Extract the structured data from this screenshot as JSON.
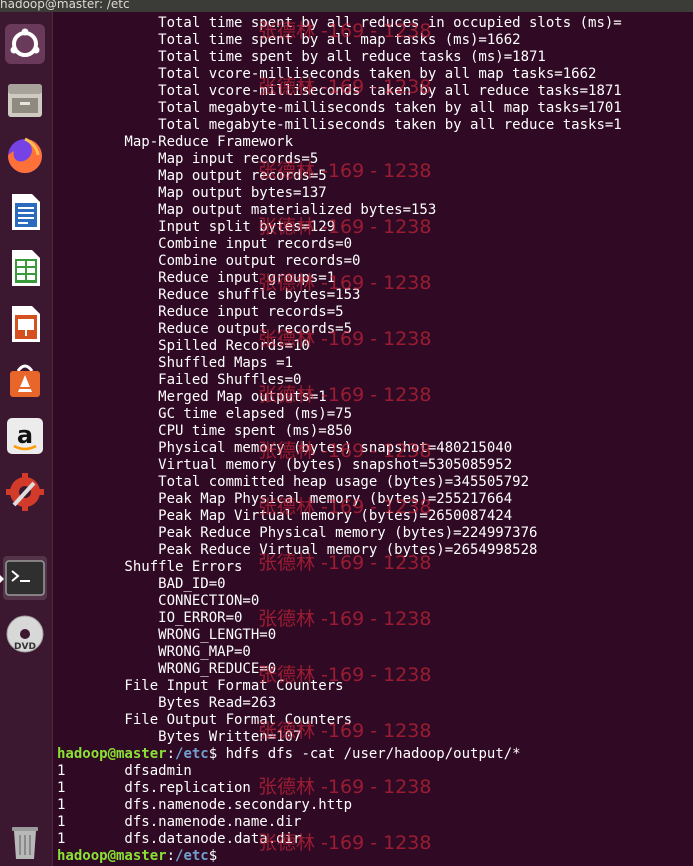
{
  "window": {
    "title": "hadoop@master: /etc"
  },
  "launcher": {
    "items": [
      {
        "name": "ubuntu-dash-icon",
        "color": "#e95420"
      },
      {
        "name": "files-icon",
        "color": "#a7a39a"
      },
      {
        "name": "firefox-icon",
        "color": "#ff7139"
      },
      {
        "name": "libreoffice-writer-icon",
        "color": "#2a6bbf"
      },
      {
        "name": "libreoffice-calc-icon",
        "color": "#3a9a3a"
      },
      {
        "name": "libreoffice-impress-icon",
        "color": "#d4501e"
      },
      {
        "name": "ubuntu-software-icon",
        "color": "#e8662a"
      },
      {
        "name": "amazon-icon",
        "color": "#ececec"
      },
      {
        "name": "system-settings-icon",
        "color": "#d23a2a"
      },
      {
        "name": "terminal-icon",
        "color": "#2f2f2f"
      },
      {
        "name": "dvd-icon",
        "color": "#d8d8d8"
      },
      {
        "name": "trash-icon",
        "color": "#b8b8b8"
      }
    ]
  },
  "terminal": {
    "lines": [
      "            Total time spent by all reduces in occupied slots (ms)=",
      "            Total time spent by all map tasks (ms)=1662",
      "            Total time spent by all reduce tasks (ms)=1871",
      "            Total vcore-milliseconds taken by all map tasks=1662",
      "            Total vcore-milliseconds taken by all reduce tasks=1871",
      "            Total megabyte-milliseconds taken by all map tasks=1701",
      "            Total megabyte-milliseconds taken by all reduce tasks=1",
      "        Map-Reduce Framework",
      "            Map input records=5",
      "            Map output records=5",
      "            Map output bytes=137",
      "            Map output materialized bytes=153",
      "            Input split bytes=129",
      "            Combine input records=0",
      "            Combine output records=0",
      "            Reduce input groups=1",
      "            Reduce shuffle bytes=153",
      "            Reduce input records=5",
      "            Reduce output records=5",
      "            Spilled Records=10",
      "            Shuffled Maps =1",
      "            Failed Shuffles=0",
      "            Merged Map outputs=1",
      "            GC time elapsed (ms)=75",
      "            CPU time spent (ms)=850",
      "            Physical memory (bytes) snapshot=480215040",
      "            Virtual memory (bytes) snapshot=5305085952",
      "            Total committed heap usage (bytes)=345505792",
      "            Peak Map Physical memory (bytes)=255217664",
      "            Peak Map Virtual memory (bytes)=2650087424",
      "            Peak Reduce Physical memory (bytes)=224997376",
      "            Peak Reduce Virtual memory (bytes)=2654998528",
      "        Shuffle Errors",
      "            BAD_ID=0",
      "            CONNECTION=0",
      "            IO_ERROR=0",
      "            WRONG_LENGTH=0",
      "            WRONG_MAP=0",
      "            WRONG_REDUCE=0",
      "        File Input Format Counters",
      "            Bytes Read=263",
      "        File Output Format Counters",
      "            Bytes Written=107"
    ],
    "prompt1": {
      "user": "hadoop@master",
      "sep": ":",
      "path": "/etc",
      "symbol": "$ ",
      "command": "hdfs dfs -cat /user/hadoop/output/*"
    },
    "output": [
      "1       dfsadmin",
      "1       dfs.replication",
      "1       dfs.namenode.secondary.http",
      "1       dfs.namenode.name.dir",
      "1       dfs.datanode.data.dir"
    ],
    "prompt2": {
      "user": "hadoop@master",
      "sep": ":",
      "path": "/etc",
      "symbol": "$"
    }
  },
  "watermark": {
    "text": "张德林 -169 - 1238"
  }
}
